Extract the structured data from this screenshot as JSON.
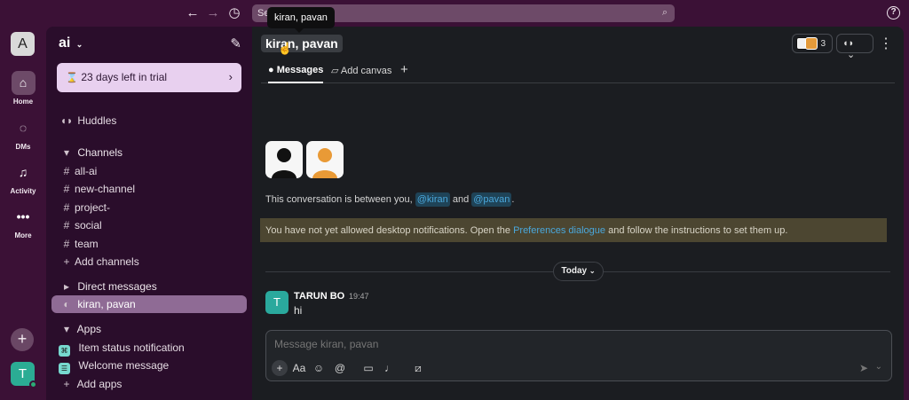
{
  "topbar": {
    "search_placeholder": "Se",
    "tooltip": "kiran, pavan"
  },
  "rail": {
    "workspace_initial": "A",
    "home": "Home",
    "dms": "DMs",
    "activity": "Activity",
    "more": "More",
    "user_initial": "T"
  },
  "sidebar": {
    "workspace_name": "ai",
    "trial": "23 days left in trial",
    "huddles": "Huddles",
    "channels_header": "Channels",
    "channels": [
      "all-ai",
      "new-channel",
      "project-",
      "social",
      "team"
    ],
    "add_channels": "Add channels",
    "dm_header": "Direct messages",
    "active_dm": "kiran, pavan",
    "apps_header": "Apps",
    "apps": [
      "Item status notification",
      "Welcome message"
    ],
    "add_apps": "Add apps"
  },
  "main": {
    "title": "kiran, pavan",
    "member_count": "3",
    "tabs": [
      "Messages",
      "Add canvas"
    ],
    "intro_prefix": "This conversation is between you, ",
    "mention_1": "@kiran",
    "intro_and": " and ",
    "mention_2": "@pavan",
    "intro_suffix": ".",
    "notice_prefix": "You have not yet allowed desktop notifications. Open the ",
    "notice_link": "Preferences dialogue",
    "notice_suffix": " and follow the instructions to set them up.",
    "today": "Today",
    "message": {
      "avatar": "T",
      "author": "TARUN BO",
      "time": "19:47",
      "text": "hi"
    },
    "composer_placeholder": "Message kiran, pavan",
    "format_label": "Aa"
  },
  "colors": {
    "brand": "#3b1136",
    "sidebar": "#2a0d2b",
    "accent": "#4aa7db",
    "message_avatar": "#2aa99d",
    "notice": "#4c4631"
  },
  "icons": {
    "back": "back-arrow-icon",
    "forward": "forward-arrow-icon",
    "history": "history-icon",
    "search": "search-icon",
    "help": "help-icon"
  }
}
